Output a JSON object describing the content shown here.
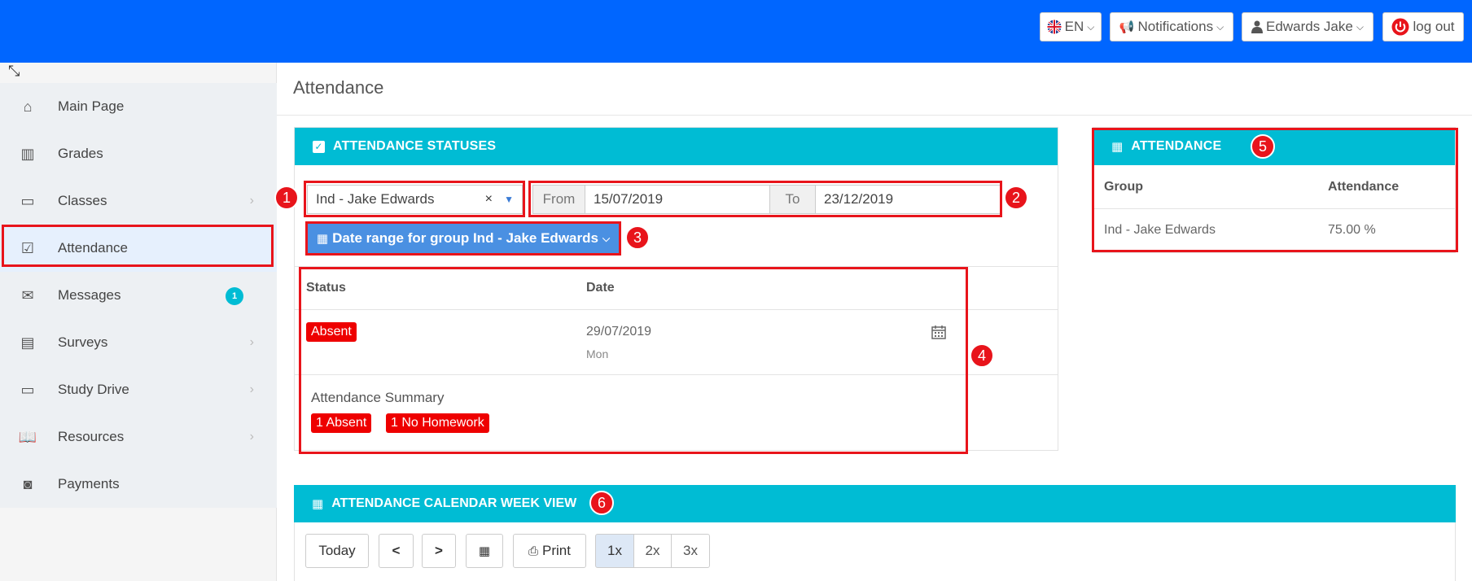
{
  "topbar": {
    "language": "EN",
    "notifications": "Notifications",
    "user": "Edwards Jake",
    "logout": "log out"
  },
  "sidebar": {
    "items": [
      {
        "label": "Main Page",
        "icon": "home-icon"
      },
      {
        "label": "Grades",
        "icon": "grades-icon"
      },
      {
        "label": "Classes",
        "icon": "calendar-icon"
      },
      {
        "label": "Attendance",
        "icon": "checkbox-icon"
      },
      {
        "label": "Messages",
        "icon": "envelope-icon",
        "badge": "1"
      },
      {
        "label": "Surveys",
        "icon": "document-icon"
      },
      {
        "label": "Study Drive",
        "icon": "calendar-icon"
      },
      {
        "label": "Resources",
        "icon": "book-icon"
      },
      {
        "label": "Payments",
        "icon": "money-icon"
      }
    ]
  },
  "page": {
    "title": "Attendance"
  },
  "statuses_panel": {
    "title": "ATTENDANCE STATUSES",
    "group_select": "Ind - Jake Edwards",
    "clear": "×",
    "from_label": "From",
    "from_value": "15/07/2019",
    "to_label": "To",
    "to_value": "23/12/2019",
    "range_button": "Date range for group Ind - Jake Edwards",
    "table": {
      "col_status": "Status",
      "col_date": "Date",
      "row": {
        "status": "Absent",
        "date": "29/07/2019",
        "weekday": "Mon"
      }
    },
    "summary_label": "Attendance Summary",
    "summary_badges": [
      "1 Absent",
      "1 No Homework"
    ]
  },
  "attendance_panel": {
    "title": "ATTENDANCE",
    "col_group": "Group",
    "col_attendance": "Attendance",
    "row": {
      "group": "Ind - Jake Edwards",
      "attendance": "75.00 %"
    }
  },
  "week_panel": {
    "title": "ATTENDANCE CALENDAR WEEK VIEW",
    "today": "Today",
    "print": "Print",
    "zoom": [
      "1x",
      "2x",
      "3x"
    ],
    "selected_zoom": "1x"
  },
  "annotations": [
    "1",
    "2",
    "3",
    "4",
    "5",
    "6"
  ],
  "colors": {
    "topbar": "#0066ff",
    "panel_header": "#00bcd4",
    "highlight": "#e8141b",
    "label_red": "#ee0000",
    "range_button": "#4a90e2"
  }
}
